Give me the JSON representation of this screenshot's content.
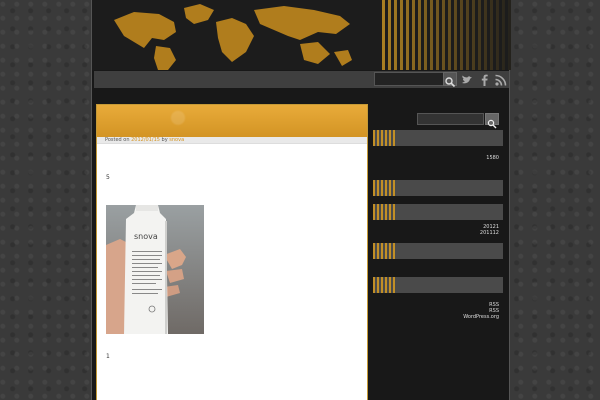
{
  "post": {
    "meta_prefix": "Posted on",
    "date": "2012/01/15",
    "by": "by",
    "author": "snova",
    "text1": "5",
    "text2": "1",
    "photo_brand": "snova"
  },
  "sidebar": {
    "count": "1580",
    "archives": [
      "20121",
      "201112"
    ],
    "meta_links": [
      "RSS",
      "RSS",
      "WordPress.org"
    ]
  },
  "colors": {
    "accent": "#d39424",
    "background": "#3a3a3a",
    "panel": "#181818"
  },
  "icons": {
    "nav_search": "search-icon",
    "twitter": "twitter-icon",
    "facebook": "facebook-icon",
    "rss": "rss-icon",
    "side_search": "search-icon"
  }
}
